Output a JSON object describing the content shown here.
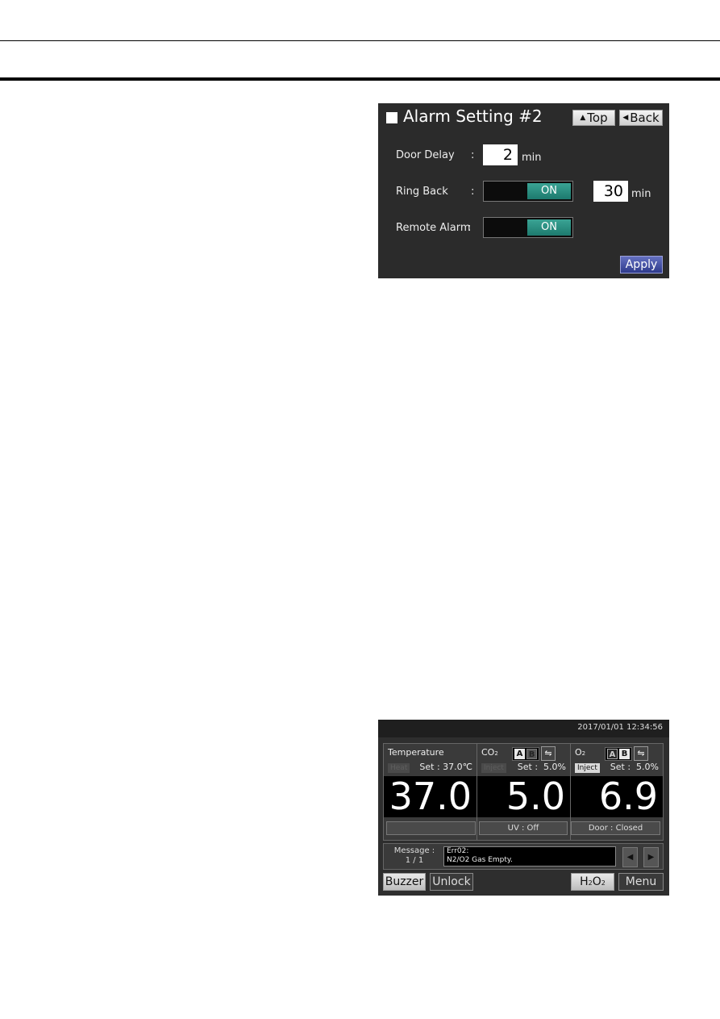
{
  "alarm_screen": {
    "title": "Alarm Setting #2",
    "top_button": "Top",
    "back_button": "Back",
    "door_delay": {
      "label": "Door Delay",
      "colon": ":",
      "value": "2",
      "unit": "min"
    },
    "ring_back": {
      "label": "Ring Back",
      "colon": ":",
      "toggle": "ON",
      "value": "30",
      "unit": "min"
    },
    "remote_alarm": {
      "label": "Remote Alarm",
      "colon": ":",
      "toggle": "ON"
    },
    "apply_button": "Apply"
  },
  "monitor_screen": {
    "datetime": "2017/01/01  12:34:56",
    "temperature": {
      "title": "Temperature",
      "tag": "Heat",
      "set": "Set : 37.0℃",
      "value": "37.0"
    },
    "co2": {
      "title_main": "CO",
      "title_sub": "2",
      "tag": "Inject",
      "set": "Set :  5.0%",
      "value": "5.0",
      "cyl_a": "A",
      "cyl_b": "B"
    },
    "o2": {
      "title_main": "O",
      "title_sub": "2",
      "tag": "Inject",
      "set": "Set :  5.0%",
      "value": "6.9",
      "cyl_a": "A",
      "cyl_b": "B"
    },
    "status_1": "",
    "status_uv": "UV : Off",
    "status_door": "Door : Closed",
    "message_label": "Message :",
    "message_page": "1 / 1",
    "message_line1": "Err02:",
    "message_line2": "N2/O2 Gas Empty.",
    "buttons": {
      "buzzer": "Buzzer",
      "unlock": "Unlock",
      "h2o2_a": "H",
      "h2o2_b": "2",
      "h2o2_c": "O",
      "h2o2_d": "2",
      "menu": "Menu"
    }
  }
}
